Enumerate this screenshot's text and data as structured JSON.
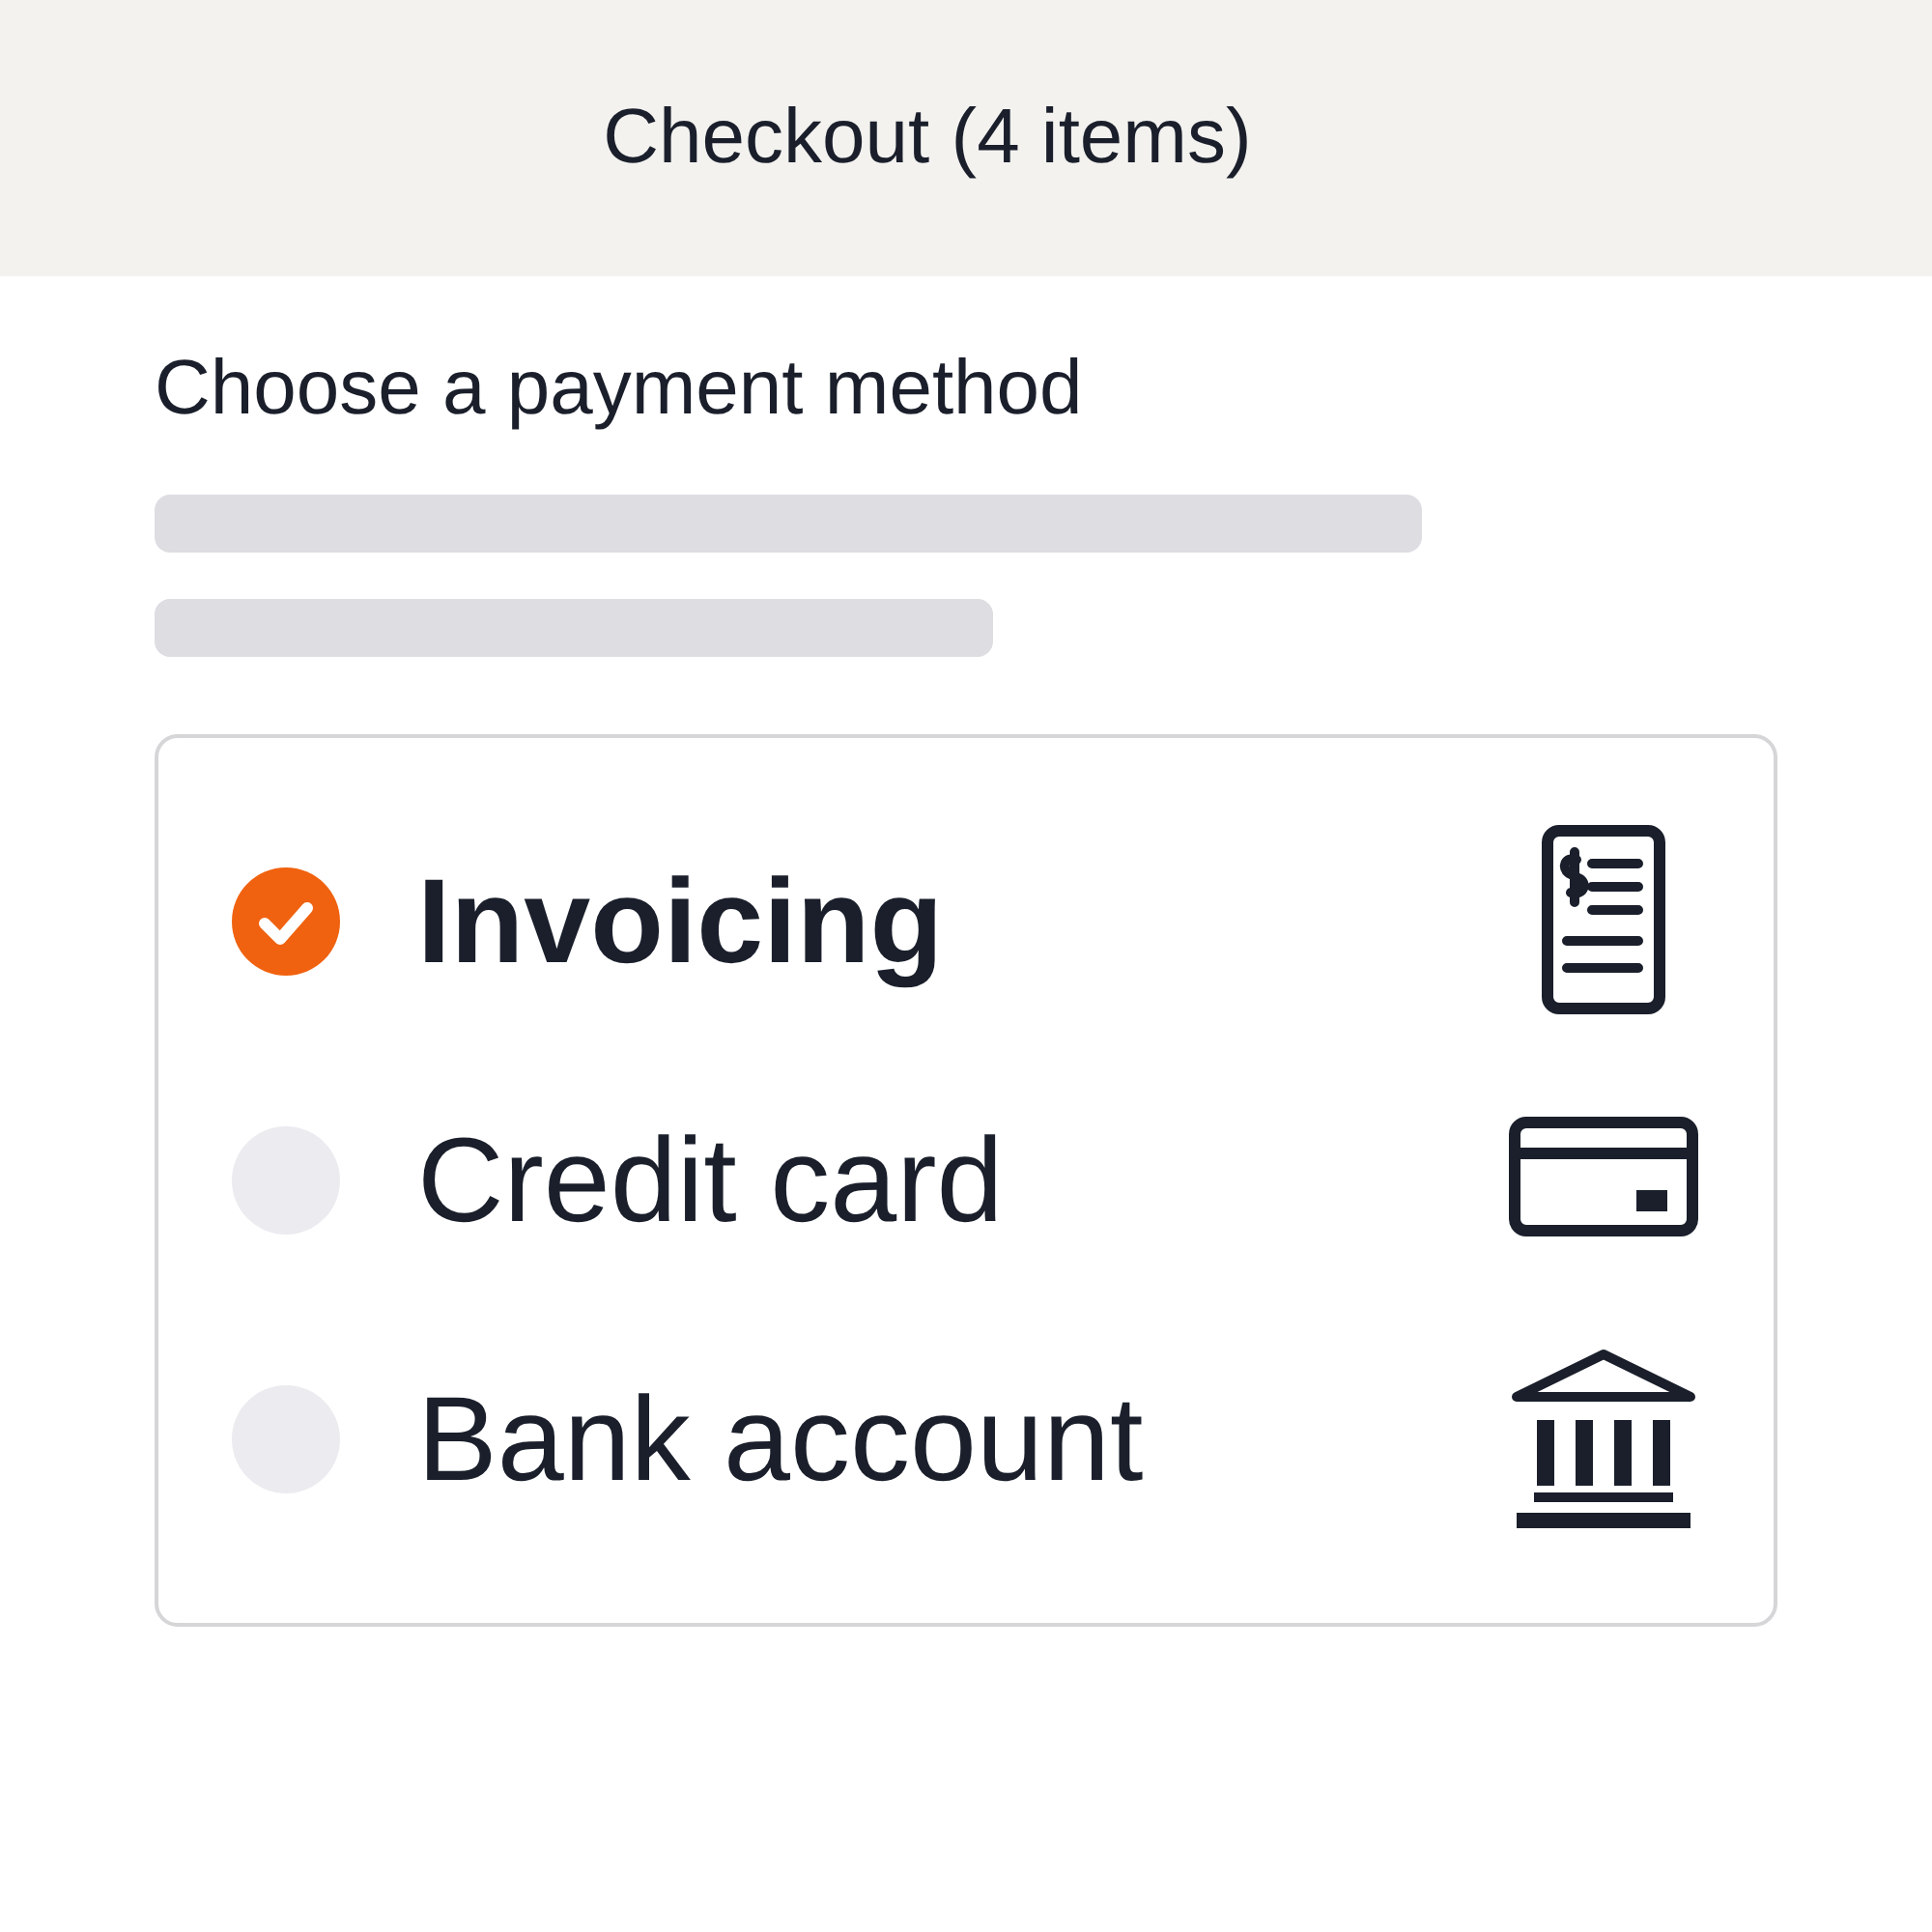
{
  "header": {
    "title": "Checkout (4 items)"
  },
  "heading": "Choose a payment method",
  "payment_methods": [
    {
      "label": "Invoicing",
      "kind": "invoice",
      "selected": true
    },
    {
      "label": "Credit card",
      "kind": "card",
      "selected": false
    },
    {
      "label": "Bank account",
      "kind": "bank",
      "selected": false
    }
  ]
}
